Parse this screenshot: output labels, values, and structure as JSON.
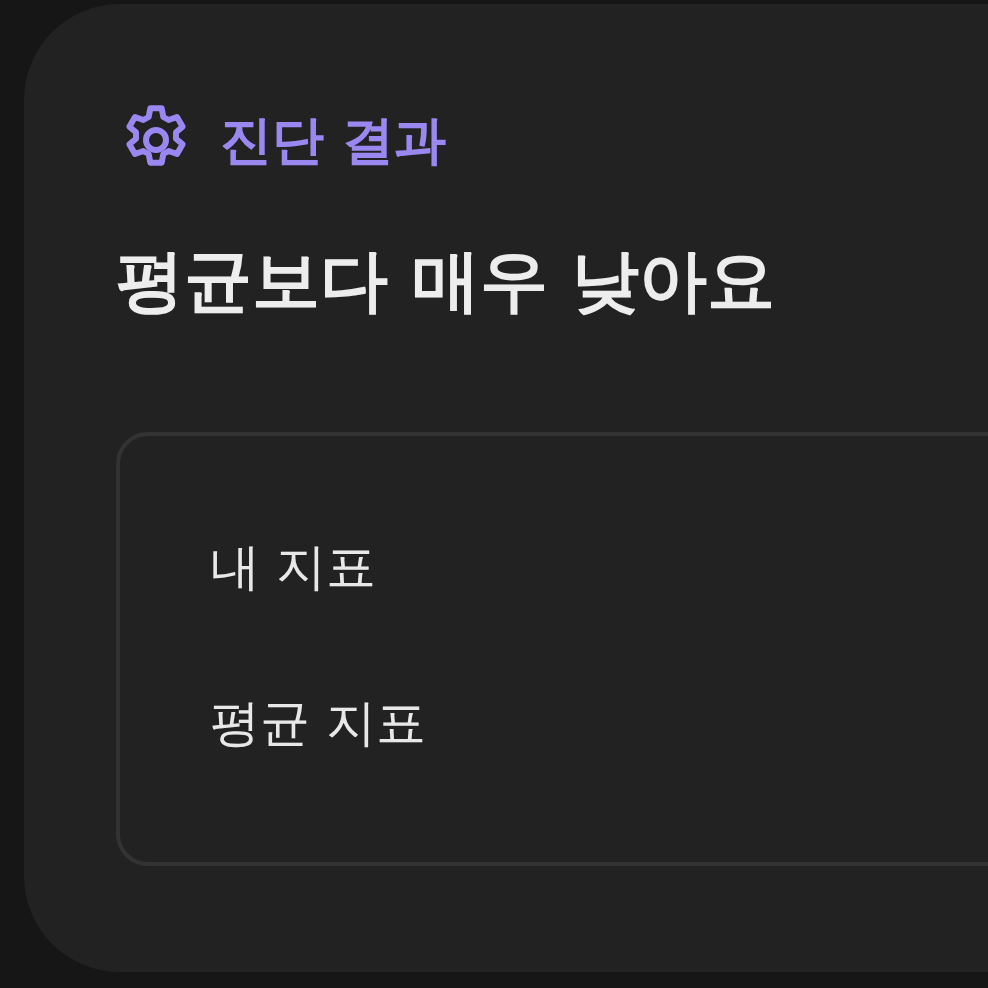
{
  "header": {
    "label": "진단 결과"
  },
  "title": "평균보다 매우 낮아요",
  "metrics": [
    {
      "label": "내 지표"
    },
    {
      "label": "평균 지표"
    }
  ]
}
